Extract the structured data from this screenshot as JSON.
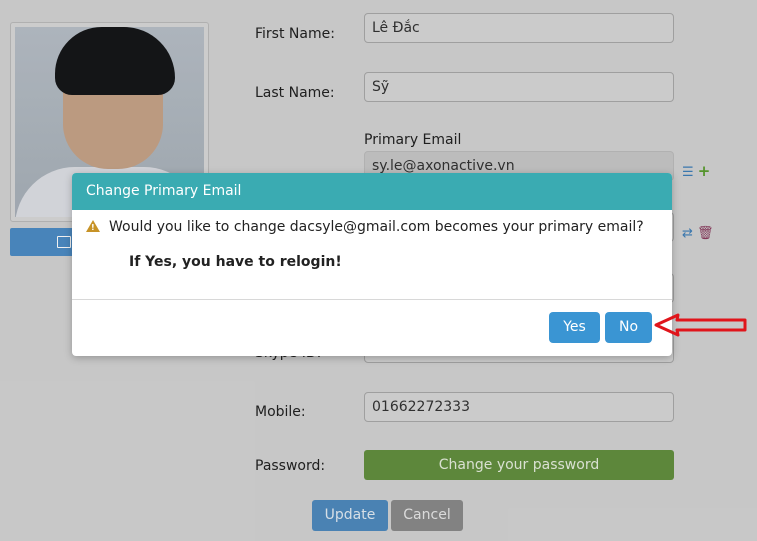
{
  "profile": {
    "photo_alt": "profile photo"
  },
  "form": {
    "first_name_label": "First Name:",
    "first_name_value": "Lê Đắc",
    "last_name_label": "Last Name:",
    "last_name_value": "Sỹ",
    "primary_email_label": "Primary Email",
    "primary_email_value": "sy.le@axonactive.vn",
    "skype_label": "Skype ID:",
    "mobile_label": "Mobile:",
    "mobile_value": "01662272333",
    "password_label": "Password:",
    "change_password_label": "Change your password",
    "update_label": "Update",
    "cancel_label": "Cancel"
  },
  "dialog": {
    "title": "Change Primary Email",
    "message": "Would you like to change dacsyle@gmail.com becomes your primary email?",
    "note": "If Yes, you have to relogin!",
    "yes_label": "Yes",
    "no_label": "No"
  },
  "colors": {
    "dialog_header": "#3aabb2",
    "button_blue": "#3a95d3",
    "annotation_arrow": "#e0151b",
    "password_button": "#63903f"
  }
}
